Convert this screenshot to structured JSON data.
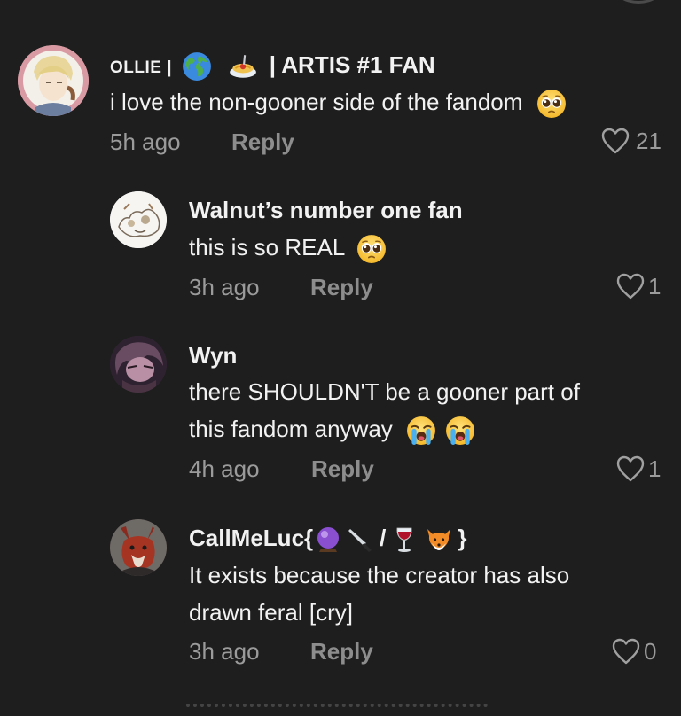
{
  "comments": [
    {
      "username_parts": {
        "pre": "OLLIE |",
        "mid": "|",
        "post": "| ARTIS #1 FAN"
      },
      "username_emojis": [
        "globe-emoji",
        "spaghetti-emoji"
      ],
      "lines": [
        "i love the non-gooner side of the fandom"
      ],
      "time": "5h ago",
      "reply": "Reply",
      "likes": "21"
    },
    {
      "username": "Walnut’s number one fan",
      "lines": [
        "this is so REAL"
      ],
      "time": "3h ago",
      "reply": "Reply",
      "likes": "1"
    },
    {
      "username": "Wyn",
      "lines": [
        "there SHOULDN'T be a gooner part of",
        "this fandom anyway"
      ],
      "time": "4h ago",
      "reply": "Reply",
      "likes": "1"
    },
    {
      "username_parts": {
        "pre": "CallMeLuc{",
        "slash": "/",
        "post": "}"
      },
      "username_emojis": [
        "crystal-ball-emoji",
        "knife-emoji",
        "wine-glass-emoji",
        "fox-emoji"
      ],
      "lines": [
        "It exists because the creator has also",
        "drawn feral [cry]"
      ],
      "time": "3h ago",
      "reply": "Reply",
      "likes": "0"
    }
  ],
  "icons": {
    "like": "heart-outline-icon",
    "pleading": "pleading-face-emoji",
    "crying": "loudly-crying-face-emoji"
  },
  "colors": {
    "background": "#1e1e1e",
    "text": "#f2f2f2",
    "muted": "#9b9b9b",
    "reply": "#8d8d8d"
  }
}
